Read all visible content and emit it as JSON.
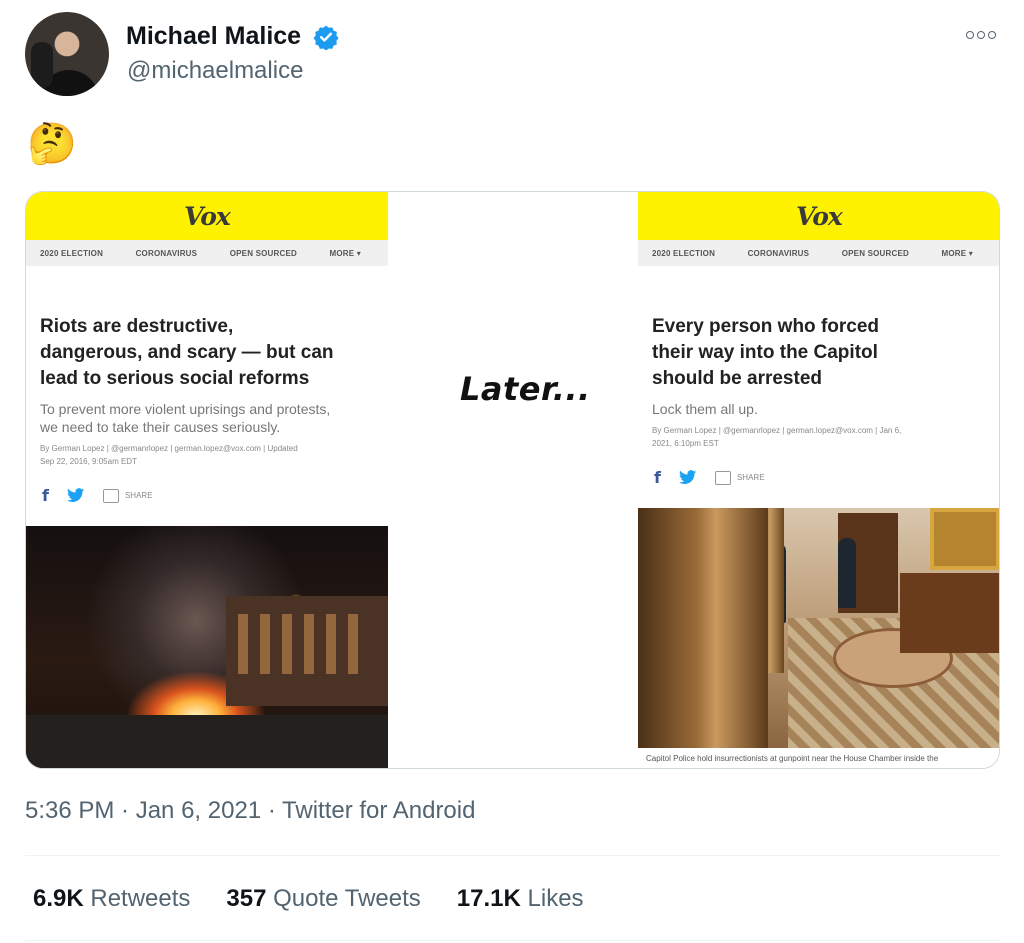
{
  "author": {
    "name": "Michael Malice",
    "handle": "@michaelmalice",
    "verified": true,
    "avatar": "avatar"
  },
  "tweet": {
    "text": "🤔"
  },
  "media": {
    "middle_text": "Later...",
    "left_article": {
      "logo": "Vox",
      "nav": [
        "2020 ELECTION",
        "CORONAVIRUS",
        "OPEN SOURCED",
        "MORE ▾"
      ],
      "headline_lines": [
        "Riots are destructive,",
        "dangerous, and scary — but can",
        "lead to serious social reforms"
      ],
      "dek_lines": [
        "To prevent more violent uprisings and protests,",
        "we need to take their causes seriously."
      ],
      "byline_lines": [
        "By German Lopez | @germanrlopez | german.lopez@vox.com | Updated",
        "Sep 22, 2016, 9:05am EDT"
      ],
      "share_label": "SHARE",
      "photo": "burning car at night"
    },
    "right_article": {
      "logo": "Vox",
      "nav": [
        "2020 ELECTION",
        "CORONAVIRUS",
        "OPEN SOURCED",
        "MORE ▾"
      ],
      "headline_lines": [
        "Every person who forced",
        "their way into the Capitol",
        "should be arrested"
      ],
      "dek_lines": [
        "Lock them all up."
      ],
      "byline_lines": [
        "By German Lopez | @germanrlopez | german.lopez@vox.com | Jan 6,",
        "2021, 6:10pm EST"
      ],
      "share_label": "SHARE",
      "photo": "Capitol interior with police",
      "caption": "Capitol Police hold insurrectionists at gunpoint near the House Chamber inside the"
    }
  },
  "timestamp": "5:36 PM · Jan 6, 2021 · Twitter for Android",
  "stats": [
    {
      "num": "6.9K",
      "label": "Retweets"
    },
    {
      "num": "357",
      "label": "Quote Tweets"
    },
    {
      "num": "17.1K",
      "label": "Likes"
    }
  ],
  "colors": {
    "vox_yellow": "#fff200",
    "verified_blue": "#1d9bf0",
    "secondary_text": "#536471"
  }
}
